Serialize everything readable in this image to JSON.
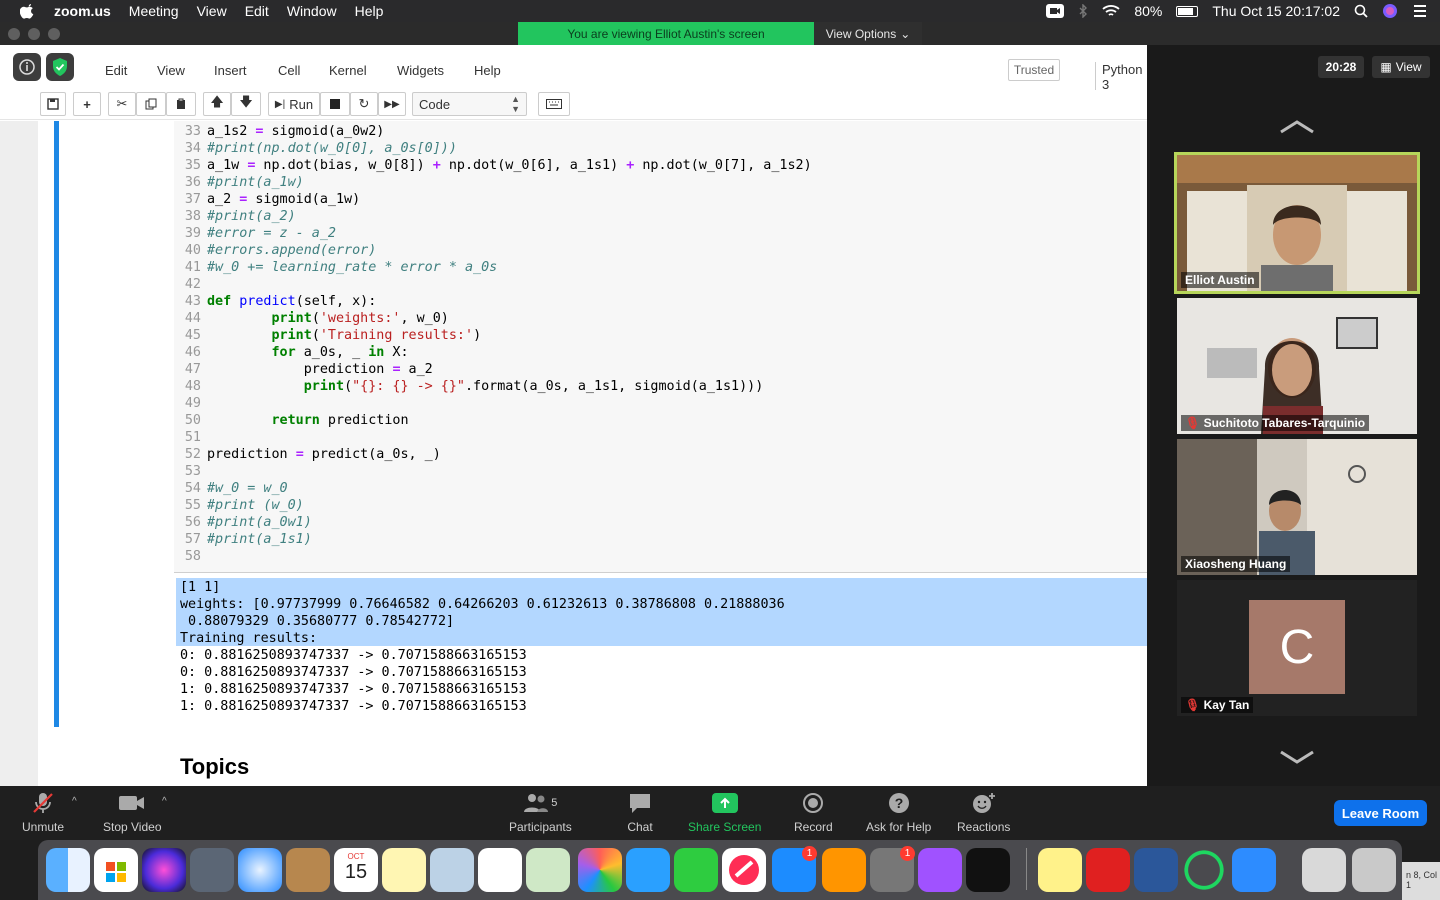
{
  "menubar": {
    "app_name": "zoom.us",
    "items": [
      "Meeting",
      "View",
      "Edit",
      "Window",
      "Help"
    ],
    "battery": "80%",
    "battery_level": 0.8,
    "datetime": "Thu Oct 15  20:17:02"
  },
  "share_banner": {
    "text": "You are viewing Elliot Austin's screen",
    "view_options": "View Options"
  },
  "jupyter": {
    "menu": [
      "Edit",
      "View",
      "Insert",
      "Cell",
      "Kernel",
      "Widgets",
      "Help"
    ],
    "trusted": "Trusted",
    "kernel": "Python 3",
    "toolbar": {
      "run": "Run",
      "cell_type": "Code"
    },
    "code_lines": [
      {
        "n": "33",
        "html": "a_1s2 <span class='op'>=</span> sigmoid(a_0w2)"
      },
      {
        "n": "34",
        "html": "<span class='cm'>#print(np.dot(w_0[0], a_0s[0]))</span>"
      },
      {
        "n": "35",
        "html": "a_1w <span class='op'>=</span> np.dot(bias, w_0[8]) <span class='op'>+</span> np.dot(w_0[6], a_1s1) <span class='op'>+</span> np.dot(w_0[7], a_1s2)"
      },
      {
        "n": "36",
        "html": "<span class='cm'>#print(a_1w)</span>"
      },
      {
        "n": "37",
        "html": "a_2 <span class='op'>=</span> sigmoid(a_1w)"
      },
      {
        "n": "38",
        "html": "<span class='cm'>#print(a_2)</span>"
      },
      {
        "n": "39",
        "html": "<span class='cm'>#error = z - a_2</span>"
      },
      {
        "n": "40",
        "html": "<span class='cm'>#errors.append(error)</span>"
      },
      {
        "n": "41",
        "html": "<span class='cm'>#w_0 += learning_rate * error * a_0s</span>"
      },
      {
        "n": "42",
        "html": ""
      },
      {
        "n": "43",
        "html": "<span class='kw'>def</span> <span class='fn'>predict</span>(self, x):"
      },
      {
        "n": "44",
        "html": "        <span class='kw'>print</span>(<span class='st'>'weights:'</span>, w_0)"
      },
      {
        "n": "45",
        "html": "        <span class='kw'>print</span>(<span class='st'>'Training results:'</span>)"
      },
      {
        "n": "46",
        "html": "        <span class='kw'>for</span> a_0s, _ <span class='kw'>in</span> X:"
      },
      {
        "n": "47",
        "html": "            prediction <span class='op'>=</span> a_2"
      },
      {
        "n": "48",
        "html": "            <span class='kw'>print</span>(<span class='st'>\"{}: {} -> {}\"</span>.format(a_0s, a_1s1, sigmoid(a_1s1)))"
      },
      {
        "n": "49",
        "html": ""
      },
      {
        "n": "50",
        "html": "        <span class='kw'>return</span> prediction"
      },
      {
        "n": "51",
        "html": ""
      },
      {
        "n": "52",
        "html": "prediction <span class='op'>=</span> predict(a_0s, _)"
      },
      {
        "n": "53",
        "html": ""
      },
      {
        "n": "54",
        "html": "<span class='cm'>#w_0 = w_0</span>"
      },
      {
        "n": "55",
        "html": "<span class='cm'>#print (w_0)</span>"
      },
      {
        "n": "56",
        "html": "<span class='cm'>#print(a_0w1)</span>"
      },
      {
        "n": "57",
        "html": "<span class='cm'>#print(a_1s1)</span>"
      },
      {
        "n": "58",
        "html": ""
      }
    ],
    "output_lines": [
      "[1 1]",
      "weights: [0.97737999 0.76646582 0.64266203 0.61232613 0.38786808 0.21888036",
      " 0.88079329 0.35680777 0.78542772]",
      "Training results:",
      "0: 0.8816250893747337 -> 0.7071588663165153",
      "0: 0.8816250893747337 -> 0.7071588663165153",
      "1: 0.8816250893747337 -> 0.7071588663165153",
      "1: 0.8816250893747337 -> 0.7071588663165153"
    ],
    "next_heading": "Topics"
  },
  "sidebar": {
    "timer": "20:28",
    "view_label": "View",
    "participants": [
      {
        "name": "Elliot Austin",
        "muted": false,
        "active": true
      },
      {
        "name": "Suchitoto Tabares-Tarquinio",
        "muted": true,
        "active": false
      },
      {
        "name": "Xiaosheng Huang",
        "muted": false,
        "active": false
      },
      {
        "name": "Kay Tan",
        "muted": true,
        "active": false,
        "avatar_letter": "C"
      }
    ]
  },
  "zoom_toolbar": {
    "unmute": "Unmute",
    "stop_video": "Stop Video",
    "participants": "Participants",
    "participants_count": "5",
    "chat": "Chat",
    "share_screen": "Share Screen",
    "record": "Record",
    "ask_for_help": "Ask for Help",
    "reactions": "Reactions",
    "leave_room": "Leave Room"
  },
  "dock": {
    "calendar_month": "OCT",
    "calendar_day": "15",
    "appstore_badge": "1",
    "sysprefs_badge": "1",
    "corner_text": "n 8, Col 1"
  },
  "colors": {
    "share_green": "#22c55e",
    "leave_blue": "#0e71eb",
    "selection": "#b3d7ff",
    "cell_border": "#1e88e5"
  }
}
